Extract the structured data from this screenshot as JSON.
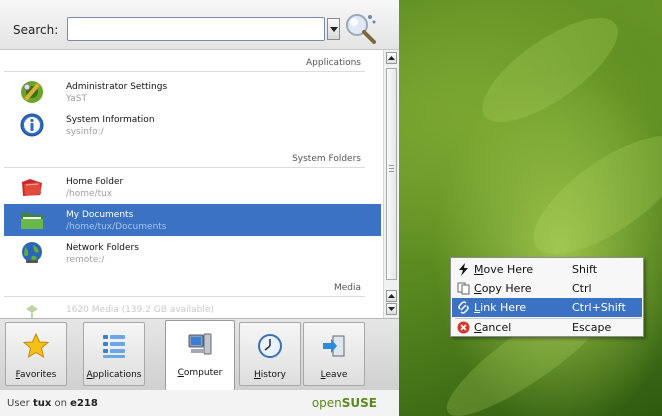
{
  "search": {
    "label": "Search:",
    "value": "",
    "placeholder": ""
  },
  "sections": {
    "applications": "Applications",
    "system_folders": "System Folders",
    "media": "Media"
  },
  "items": [
    {
      "title": "Administrator Settings",
      "subtitle": "YaST",
      "icon": "yast-icon"
    },
    {
      "title": "System Information",
      "subtitle": "sysinfo:/",
      "icon": "info-icon"
    },
    {
      "title": "Home Folder",
      "subtitle": "/home/tux",
      "icon": "home-folder-icon"
    },
    {
      "title": "My Documents",
      "subtitle": "/home/tux/Documents",
      "icon": "documents-folder-icon",
      "selected": true
    },
    {
      "title": "Network Folders",
      "subtitle": "remote:/",
      "icon": "network-icon"
    },
    {
      "title": "1620 Media (139.2 GB available)",
      "icon": "media-icon"
    }
  ],
  "tabs": [
    {
      "label_prefix": "",
      "label_u": "F",
      "label_rest": "avorites",
      "icon": "star-icon"
    },
    {
      "label_prefix": "",
      "label_u": "A",
      "label_rest": "pplications",
      "icon": "applications-list-icon"
    },
    {
      "label_prefix": "",
      "label_u": "C",
      "label_rest": "omputer",
      "icon": "computer-icon",
      "active": true
    },
    {
      "label_prefix": "",
      "label_u": "H",
      "label_rest": "istory",
      "icon": "clock-icon"
    },
    {
      "label_prefix": "",
      "label_u": "L",
      "label_rest": "eave",
      "icon": "leave-icon"
    }
  ],
  "footer": {
    "user_prefix": "User ",
    "username": "tux",
    "on": " on ",
    "host": "e218",
    "brand_a": "open",
    "brand_b": "SUSE"
  },
  "context_menu": [
    {
      "label_u": "M",
      "label_rest": "ove Here",
      "shortcut": "Shift",
      "icon": "move-icon"
    },
    {
      "label_u": "C",
      "label_rest": "opy Here",
      "shortcut": "Ctrl",
      "icon": "copy-icon"
    },
    {
      "label_u": "L",
      "label_rest": "ink Here",
      "shortcut": "Ctrl+Shift",
      "icon": "link-icon",
      "highlighted": true
    },
    {
      "label_u": "C",
      "label_rest": "ancel",
      "shortcut": "Escape",
      "icon": "cancel-icon"
    }
  ],
  "colors": {
    "selection": "#3c72c4",
    "brand_green": "#5a8a1c"
  }
}
